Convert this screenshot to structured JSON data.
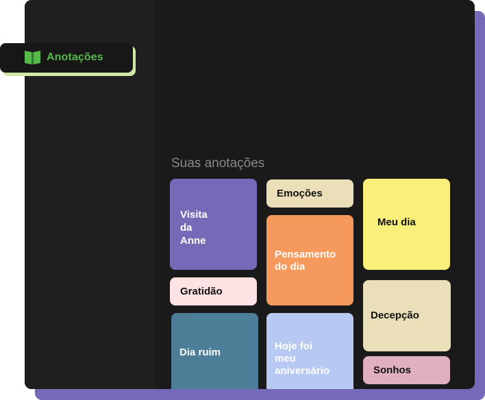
{
  "sidebar": {
    "nav_item": {
      "label": "Anotações",
      "icon": "book-icon",
      "accent": "#57b84c"
    }
  },
  "notes": {
    "section_title": "Suas anotações",
    "cards": [
      {
        "id": "visita",
        "label": "Visita\nda\nAnne",
        "bg": "#7569b8",
        "fg": "#ffffff"
      },
      {
        "id": "gratidao",
        "label": "Gratidão",
        "bg": "#fde3e3",
        "fg": "#111111"
      },
      {
        "id": "diaruim",
        "label": "Dia ruim",
        "bg": "#4d7e98",
        "fg": "#ffffff"
      },
      {
        "id": "emocoes",
        "label": "Emoções",
        "bg": "#eadfb8",
        "fg": "#111111"
      },
      {
        "id": "pensam",
        "label": "Pensamento\ndo dia",
        "bg": "#f59a5c",
        "fg": "#ffffff"
      },
      {
        "id": "hoje",
        "label": "Hoje foi\nmeu\naniversário",
        "bg": "#b7c8f2",
        "fg": "#ffffff"
      },
      {
        "id": "meudia",
        "label": "Meu dia",
        "bg": "#f9ef7a",
        "fg": "#111111"
      },
      {
        "id": "decepcao",
        "label": "Decepção",
        "bg": "#eadfb8",
        "fg": "#111111"
      },
      {
        "id": "sonhos",
        "label": "Sonhos",
        "bg": "#e0afc0",
        "fg": "#111111"
      }
    ]
  }
}
